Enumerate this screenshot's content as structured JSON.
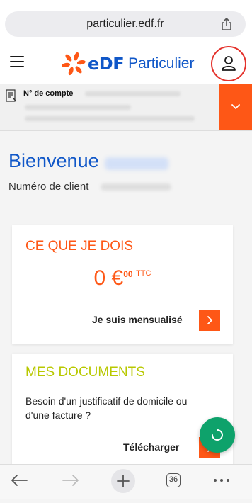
{
  "browser": {
    "url": "particulier.edf.fr",
    "tabs_count": "36"
  },
  "header": {
    "logo_brand": "eDF",
    "logo_text": "Particulier"
  },
  "contract": {
    "label": "N° de compte"
  },
  "welcome": {
    "title": "Bienvenue",
    "client_number_label": "Numéro de client"
  },
  "card_dues": {
    "title": "CE QUE JE DOIS",
    "amount_int": "0 €",
    "amount_dec": "00",
    "amount_suffix": "TTC",
    "link_label": "Je suis mensualisé"
  },
  "card_documents": {
    "title": "MES DOCUMENTS",
    "text": "Besoin d'un justificatif de domicile ou d'une facture ?",
    "link_label": "Télécharger"
  },
  "colors": {
    "brand_blue": "#1057c8",
    "accent_orange": "#fe5716",
    "title_yellow_green": "#b8c800",
    "fab_green": "#0ea26b",
    "focus_ring_red": "#e4312b"
  }
}
